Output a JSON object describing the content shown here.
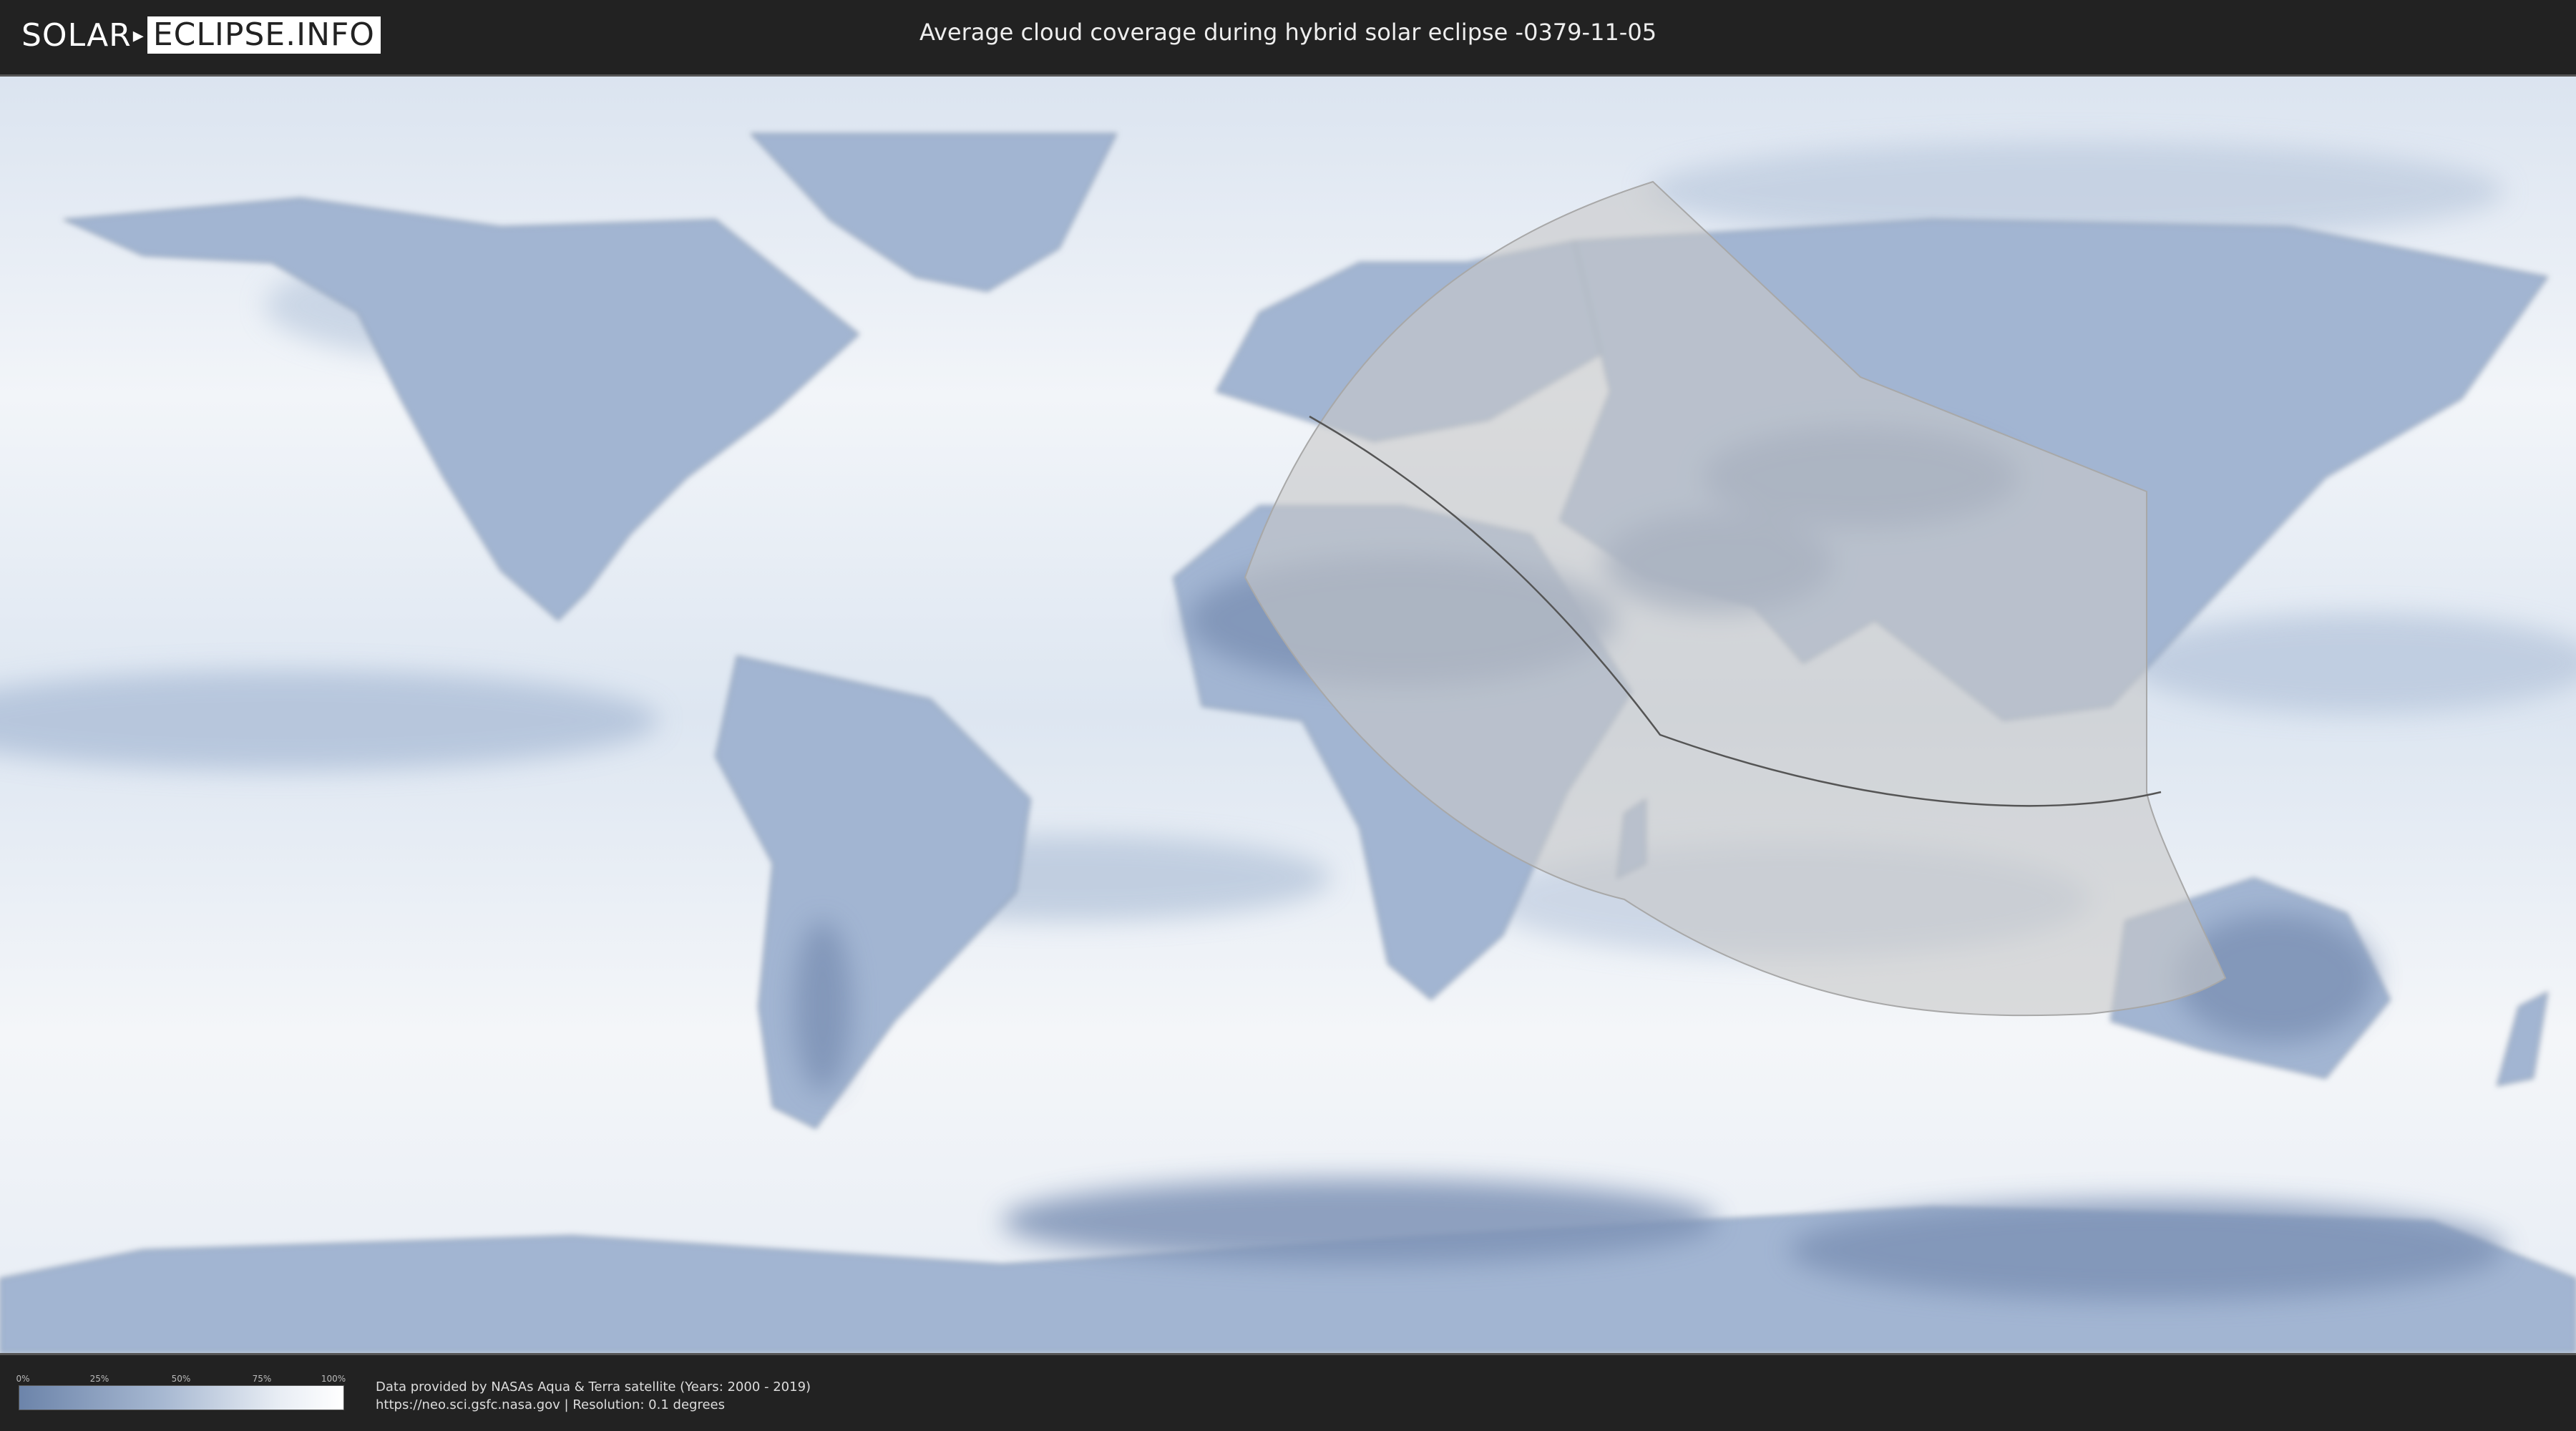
{
  "header": {
    "logo_part1": "SOLAR",
    "logo_part2": "ECLIPSE.INFO",
    "title": "Average cloud coverage during hybrid solar eclipse -0379-11-05"
  },
  "legend": {
    "ticks": [
      "0%",
      "25%",
      "50%",
      "75%",
      "100%"
    ],
    "gradient_colors": [
      "#6c84aa",
      "#a8b9d2",
      "#e8edf4",
      "#ffffff"
    ]
  },
  "footer": {
    "line1": "Data provided by NASAs Aqua & Terra satellite (Years: 2000 - 2019)",
    "line2": "https://neo.sci.gsfc.nasa.gov | Resolution: 0.1 degrees"
  },
  "map": {
    "ocean_color": "#dfe7f1",
    "land_color": "#9bb0cf",
    "eclipse_zone_color": "#c8c8c8",
    "path_color": "#555555"
  }
}
